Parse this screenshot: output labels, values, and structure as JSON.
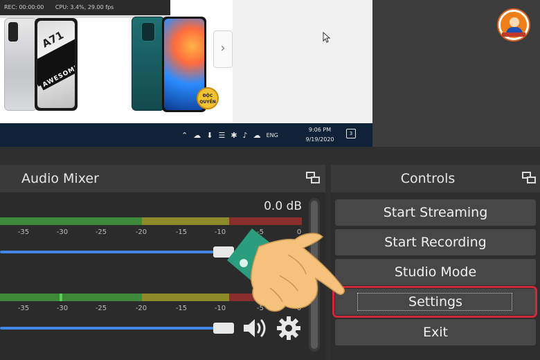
{
  "preview": {
    "stats": [
      "REC: 00:00:00",
      "CPU: 3.4%, 29.00 fps"
    ],
    "next_arrow": "›",
    "badge_text": "ĐỘC\nQUYỀN",
    "phone_model": "A71",
    "phone_slogan": "AWESOME"
  },
  "taskbar": {
    "language": "ENG",
    "time": "9:06 PM",
    "date": "9/19/2020",
    "notifications": "3"
  },
  "audio_mixer": {
    "title": "Audio Mixer",
    "readout": "0.0 dB",
    "ticks": [
      "-35",
      "-30",
      "-25",
      "-20",
      "-15",
      "-10",
      "-5",
      "0"
    ],
    "channels": [
      {
        "level": 0.0,
        "volume": 0.93
      },
      {
        "level": 0.2,
        "volume": 0.93
      }
    ]
  },
  "controls": {
    "title": "Controls",
    "buttons": [
      "Start Streaming",
      "Start Recording",
      "Studio Mode",
      "Settings",
      "Exit"
    ]
  },
  "icons": [
    "float-dock-icon",
    "speaker-icon",
    "gear-icon",
    "pointing-hand-icon",
    "site-logo"
  ]
}
